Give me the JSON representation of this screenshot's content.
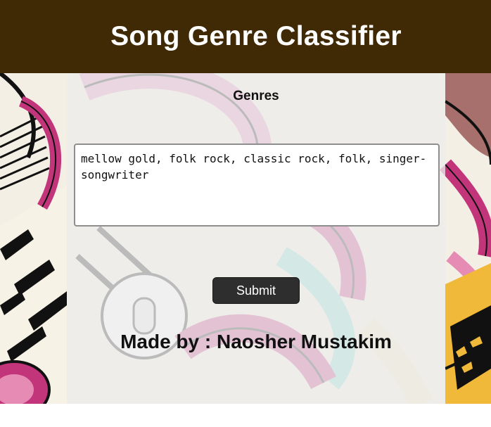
{
  "header": {
    "title": "Song Genre Classifier"
  },
  "form": {
    "genres_label": "Genres",
    "genres_value": "mellow gold, folk rock, classic rock, folk, singer-songwriter",
    "submit_label": "Submit"
  },
  "footer": {
    "credit": "Made by : Naosher Mustakim"
  },
  "colors": {
    "header_bg": "#3f2a05",
    "header_text": "#ffffff",
    "button_bg": "#2e2e2e",
    "background_art": [
      "#c2357a",
      "#e58bb4",
      "#f5d7e6",
      "#111111",
      "#f6e9c2",
      "#7fdad0",
      "#f0b93a"
    ]
  }
}
